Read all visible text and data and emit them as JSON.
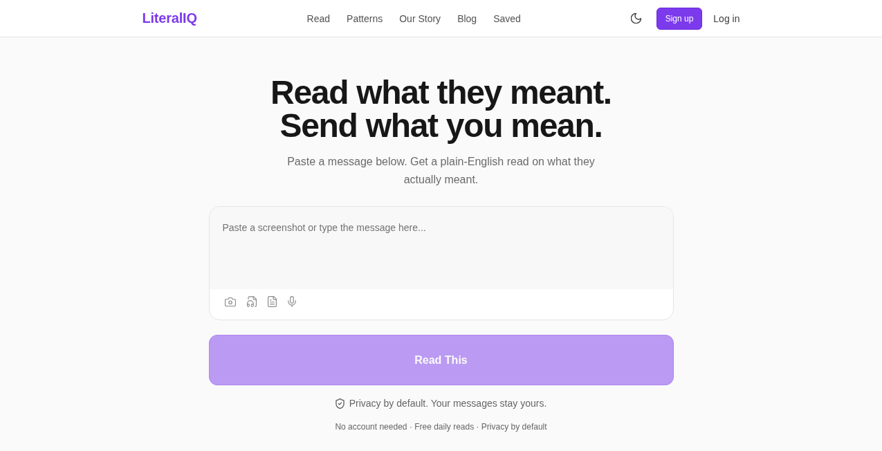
{
  "header": {
    "logo": "LiteralIQ",
    "nav": [
      "Read",
      "Patterns",
      "Our Story",
      "Blog",
      "Saved"
    ],
    "signup": "Sign up",
    "login": "Log in"
  },
  "hero": {
    "title_lines": [
      "Read what they meant.",
      "Send what you mean."
    ],
    "subtitle": "Paste a message below. Get a plain-English read on what they actually meant."
  },
  "composer": {
    "placeholder": "Paste a screenshot or type the message here..."
  },
  "submit": {
    "label": "Read This",
    "disabled": true
  },
  "privacy_note": "Privacy by default. Your messages stay yours.",
  "footer_note": "No account needed · Free daily reads · Privacy by default"
}
